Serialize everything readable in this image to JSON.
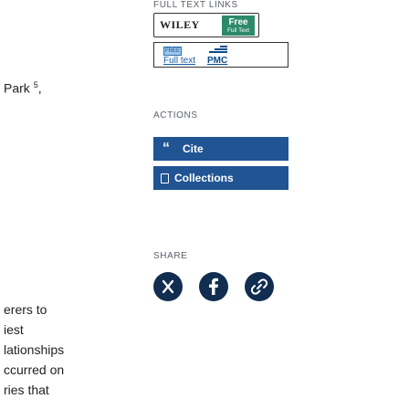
{
  "article_fragments": [
    {
      "text": "Park ",
      "sup": "5",
      "after": ","
    },
    {
      "text": "erers to"
    },
    {
      "text": "iest"
    },
    {
      "text": "lationships"
    },
    {
      "text": "ccurred on"
    },
    {
      "text": "ries that"
    }
  ],
  "full_text_links": {
    "heading": "FULL TEXT LINKS",
    "wiley": {
      "brand": "WILEY",
      "badge_top": "Free",
      "badge_bottom": "Full Text",
      "badge_color": "#2c8a6a"
    },
    "pmc": {
      "free_tag": "FREE",
      "fulltext_label": "Full text",
      "pmc_label": "PMC"
    }
  },
  "actions": {
    "heading": "ACTIONS",
    "cite_label": "Cite",
    "collections_label": "Collections",
    "button_color": "#205493"
  },
  "share": {
    "heading": "SHARE",
    "icons": [
      "x-icon",
      "facebook-icon",
      "permalink-icon"
    ]
  }
}
